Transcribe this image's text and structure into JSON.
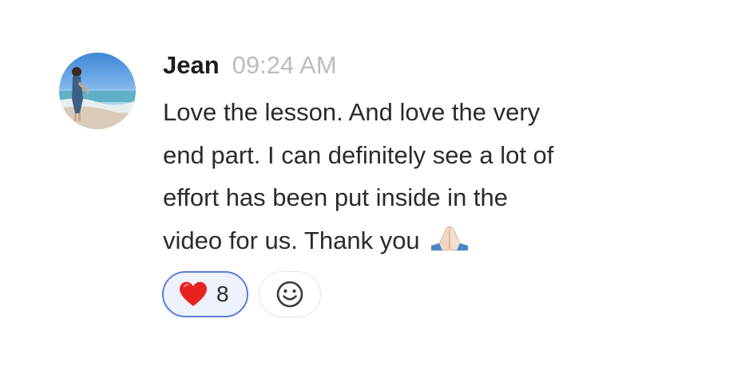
{
  "message": {
    "author": "Jean",
    "timestamp": "09:24 AM",
    "text_lines": [
      "Love the lesson. And love the very",
      "end part. I can definitely see a lot of",
      "effort has been put inside in the",
      "video for us. Thank you"
    ],
    "inline_emoji": "folded-hands-emoji",
    "avatar": "user-avatar-beach-photo"
  },
  "reactions": [
    {
      "emoji": "red-heart-emoji",
      "count": "8",
      "selected": true
    }
  ],
  "add_reaction": {
    "icon": "smiley-add-reaction-icon"
  },
  "colors": {
    "reaction_selected_border": "#5a7fd8",
    "reaction_selected_bg": "#eef2fc",
    "timestamp": "#b9bcc2"
  }
}
